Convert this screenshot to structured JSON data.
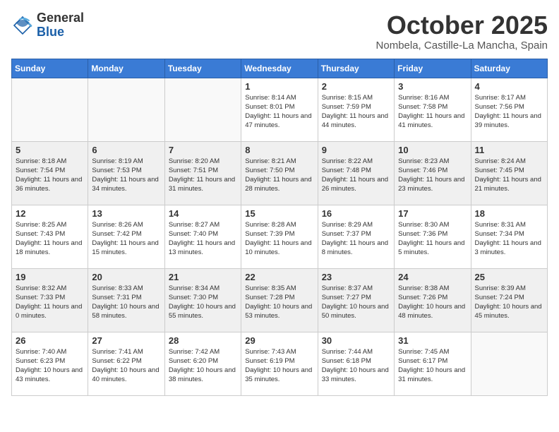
{
  "header": {
    "logo_general": "General",
    "logo_blue": "Blue",
    "month_title": "October 2025",
    "location": "Nombela, Castille-La Mancha, Spain"
  },
  "days_of_week": [
    "Sunday",
    "Monday",
    "Tuesday",
    "Wednesday",
    "Thursday",
    "Friday",
    "Saturday"
  ],
  "weeks": [
    [
      {
        "day": "",
        "info": ""
      },
      {
        "day": "",
        "info": ""
      },
      {
        "day": "",
        "info": ""
      },
      {
        "day": "1",
        "info": "Sunrise: 8:14 AM\nSunset: 8:01 PM\nDaylight: 11 hours and 47 minutes."
      },
      {
        "day": "2",
        "info": "Sunrise: 8:15 AM\nSunset: 7:59 PM\nDaylight: 11 hours and 44 minutes."
      },
      {
        "day": "3",
        "info": "Sunrise: 8:16 AM\nSunset: 7:58 PM\nDaylight: 11 hours and 41 minutes."
      },
      {
        "day": "4",
        "info": "Sunrise: 8:17 AM\nSunset: 7:56 PM\nDaylight: 11 hours and 39 minutes."
      }
    ],
    [
      {
        "day": "5",
        "info": "Sunrise: 8:18 AM\nSunset: 7:54 PM\nDaylight: 11 hours and 36 minutes."
      },
      {
        "day": "6",
        "info": "Sunrise: 8:19 AM\nSunset: 7:53 PM\nDaylight: 11 hours and 34 minutes."
      },
      {
        "day": "7",
        "info": "Sunrise: 8:20 AM\nSunset: 7:51 PM\nDaylight: 11 hours and 31 minutes."
      },
      {
        "day": "8",
        "info": "Sunrise: 8:21 AM\nSunset: 7:50 PM\nDaylight: 11 hours and 28 minutes."
      },
      {
        "day": "9",
        "info": "Sunrise: 8:22 AM\nSunset: 7:48 PM\nDaylight: 11 hours and 26 minutes."
      },
      {
        "day": "10",
        "info": "Sunrise: 8:23 AM\nSunset: 7:46 PM\nDaylight: 11 hours and 23 minutes."
      },
      {
        "day": "11",
        "info": "Sunrise: 8:24 AM\nSunset: 7:45 PM\nDaylight: 11 hours and 21 minutes."
      }
    ],
    [
      {
        "day": "12",
        "info": "Sunrise: 8:25 AM\nSunset: 7:43 PM\nDaylight: 11 hours and 18 minutes."
      },
      {
        "day": "13",
        "info": "Sunrise: 8:26 AM\nSunset: 7:42 PM\nDaylight: 11 hours and 15 minutes."
      },
      {
        "day": "14",
        "info": "Sunrise: 8:27 AM\nSunset: 7:40 PM\nDaylight: 11 hours and 13 minutes."
      },
      {
        "day": "15",
        "info": "Sunrise: 8:28 AM\nSunset: 7:39 PM\nDaylight: 11 hours and 10 minutes."
      },
      {
        "day": "16",
        "info": "Sunrise: 8:29 AM\nSunset: 7:37 PM\nDaylight: 11 hours and 8 minutes."
      },
      {
        "day": "17",
        "info": "Sunrise: 8:30 AM\nSunset: 7:36 PM\nDaylight: 11 hours and 5 minutes."
      },
      {
        "day": "18",
        "info": "Sunrise: 8:31 AM\nSunset: 7:34 PM\nDaylight: 11 hours and 3 minutes."
      }
    ],
    [
      {
        "day": "19",
        "info": "Sunrise: 8:32 AM\nSunset: 7:33 PM\nDaylight: 11 hours and 0 minutes."
      },
      {
        "day": "20",
        "info": "Sunrise: 8:33 AM\nSunset: 7:31 PM\nDaylight: 10 hours and 58 minutes."
      },
      {
        "day": "21",
        "info": "Sunrise: 8:34 AM\nSunset: 7:30 PM\nDaylight: 10 hours and 55 minutes."
      },
      {
        "day": "22",
        "info": "Sunrise: 8:35 AM\nSunset: 7:28 PM\nDaylight: 10 hours and 53 minutes."
      },
      {
        "day": "23",
        "info": "Sunrise: 8:37 AM\nSunset: 7:27 PM\nDaylight: 10 hours and 50 minutes."
      },
      {
        "day": "24",
        "info": "Sunrise: 8:38 AM\nSunset: 7:26 PM\nDaylight: 10 hours and 48 minutes."
      },
      {
        "day": "25",
        "info": "Sunrise: 8:39 AM\nSunset: 7:24 PM\nDaylight: 10 hours and 45 minutes."
      }
    ],
    [
      {
        "day": "26",
        "info": "Sunrise: 7:40 AM\nSunset: 6:23 PM\nDaylight: 10 hours and 43 minutes."
      },
      {
        "day": "27",
        "info": "Sunrise: 7:41 AM\nSunset: 6:22 PM\nDaylight: 10 hours and 40 minutes."
      },
      {
        "day": "28",
        "info": "Sunrise: 7:42 AM\nSunset: 6:20 PM\nDaylight: 10 hours and 38 minutes."
      },
      {
        "day": "29",
        "info": "Sunrise: 7:43 AM\nSunset: 6:19 PM\nDaylight: 10 hours and 35 minutes."
      },
      {
        "day": "30",
        "info": "Sunrise: 7:44 AM\nSunset: 6:18 PM\nDaylight: 10 hours and 33 minutes."
      },
      {
        "day": "31",
        "info": "Sunrise: 7:45 AM\nSunset: 6:17 PM\nDaylight: 10 hours and 31 minutes."
      },
      {
        "day": "",
        "info": ""
      }
    ]
  ]
}
